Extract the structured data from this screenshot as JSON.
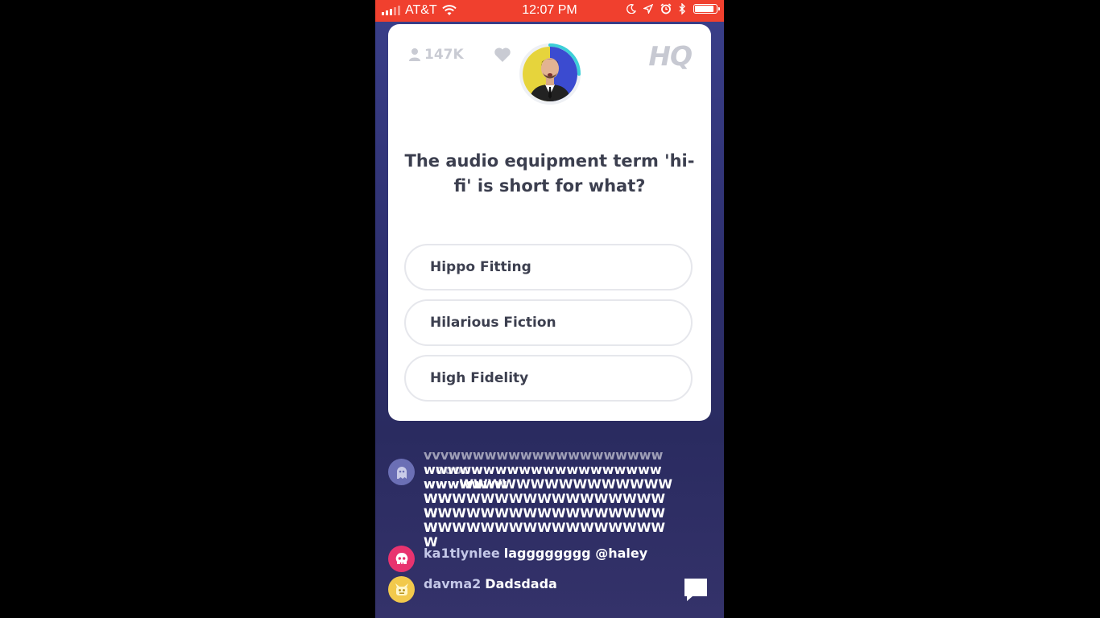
{
  "status_bar": {
    "carrier": "AT&T",
    "time": "12:07 PM",
    "battery_level": 0.95,
    "icons": [
      "signal-icon",
      "wifi-icon",
      "moon-icon",
      "location-icon",
      "alarm-icon",
      "bluetooth-icon",
      "battery-icon"
    ]
  },
  "header": {
    "viewer_count": "147K",
    "logo": "HQ",
    "timer_progress": 0.25
  },
  "question": {
    "text": "The audio equipment term 'hi-fi' is short for what?"
  },
  "answers": [
    {
      "label": "Hippo Fitting"
    },
    {
      "label": "Hilarious Fiction"
    },
    {
      "label": "High Fidelity"
    }
  ],
  "chat": {
    "messages": [
      {
        "username": "",
        "text_lines": [
          "vvvwwwwwwwwwwwwwwwwwwwoooow",
          "wwwwwwwwwwwwwwwwwwwwwwwwwww",
          "wwwWWWWWWWWWWWWWWWWW",
          "WWWWWWWWWWWWWWWWWW",
          "WWWWWWWWWWWWWWWWWW",
          "WWWWWWWWWWWWWWWWWW"
        ],
        "avatar_color": "#6b6fb5",
        "avatar_icon": "ghost-icon"
      },
      {
        "username": "ka1tlynlee",
        "text": "lagggggggg @haley",
        "avatar_color": "#e8336f",
        "avatar_icon": "skull-icon"
      },
      {
        "username": "davma2",
        "text": "Dadsdada",
        "avatar_color": "#f2c94c",
        "avatar_icon": "monster-icon"
      }
    ]
  },
  "colors": {
    "status_bar": "#f0402e",
    "background_top": "#3a3f8a",
    "background_bottom": "#2a2b60",
    "card": "#ffffff",
    "timer_ring": "#3ccfd8"
  }
}
